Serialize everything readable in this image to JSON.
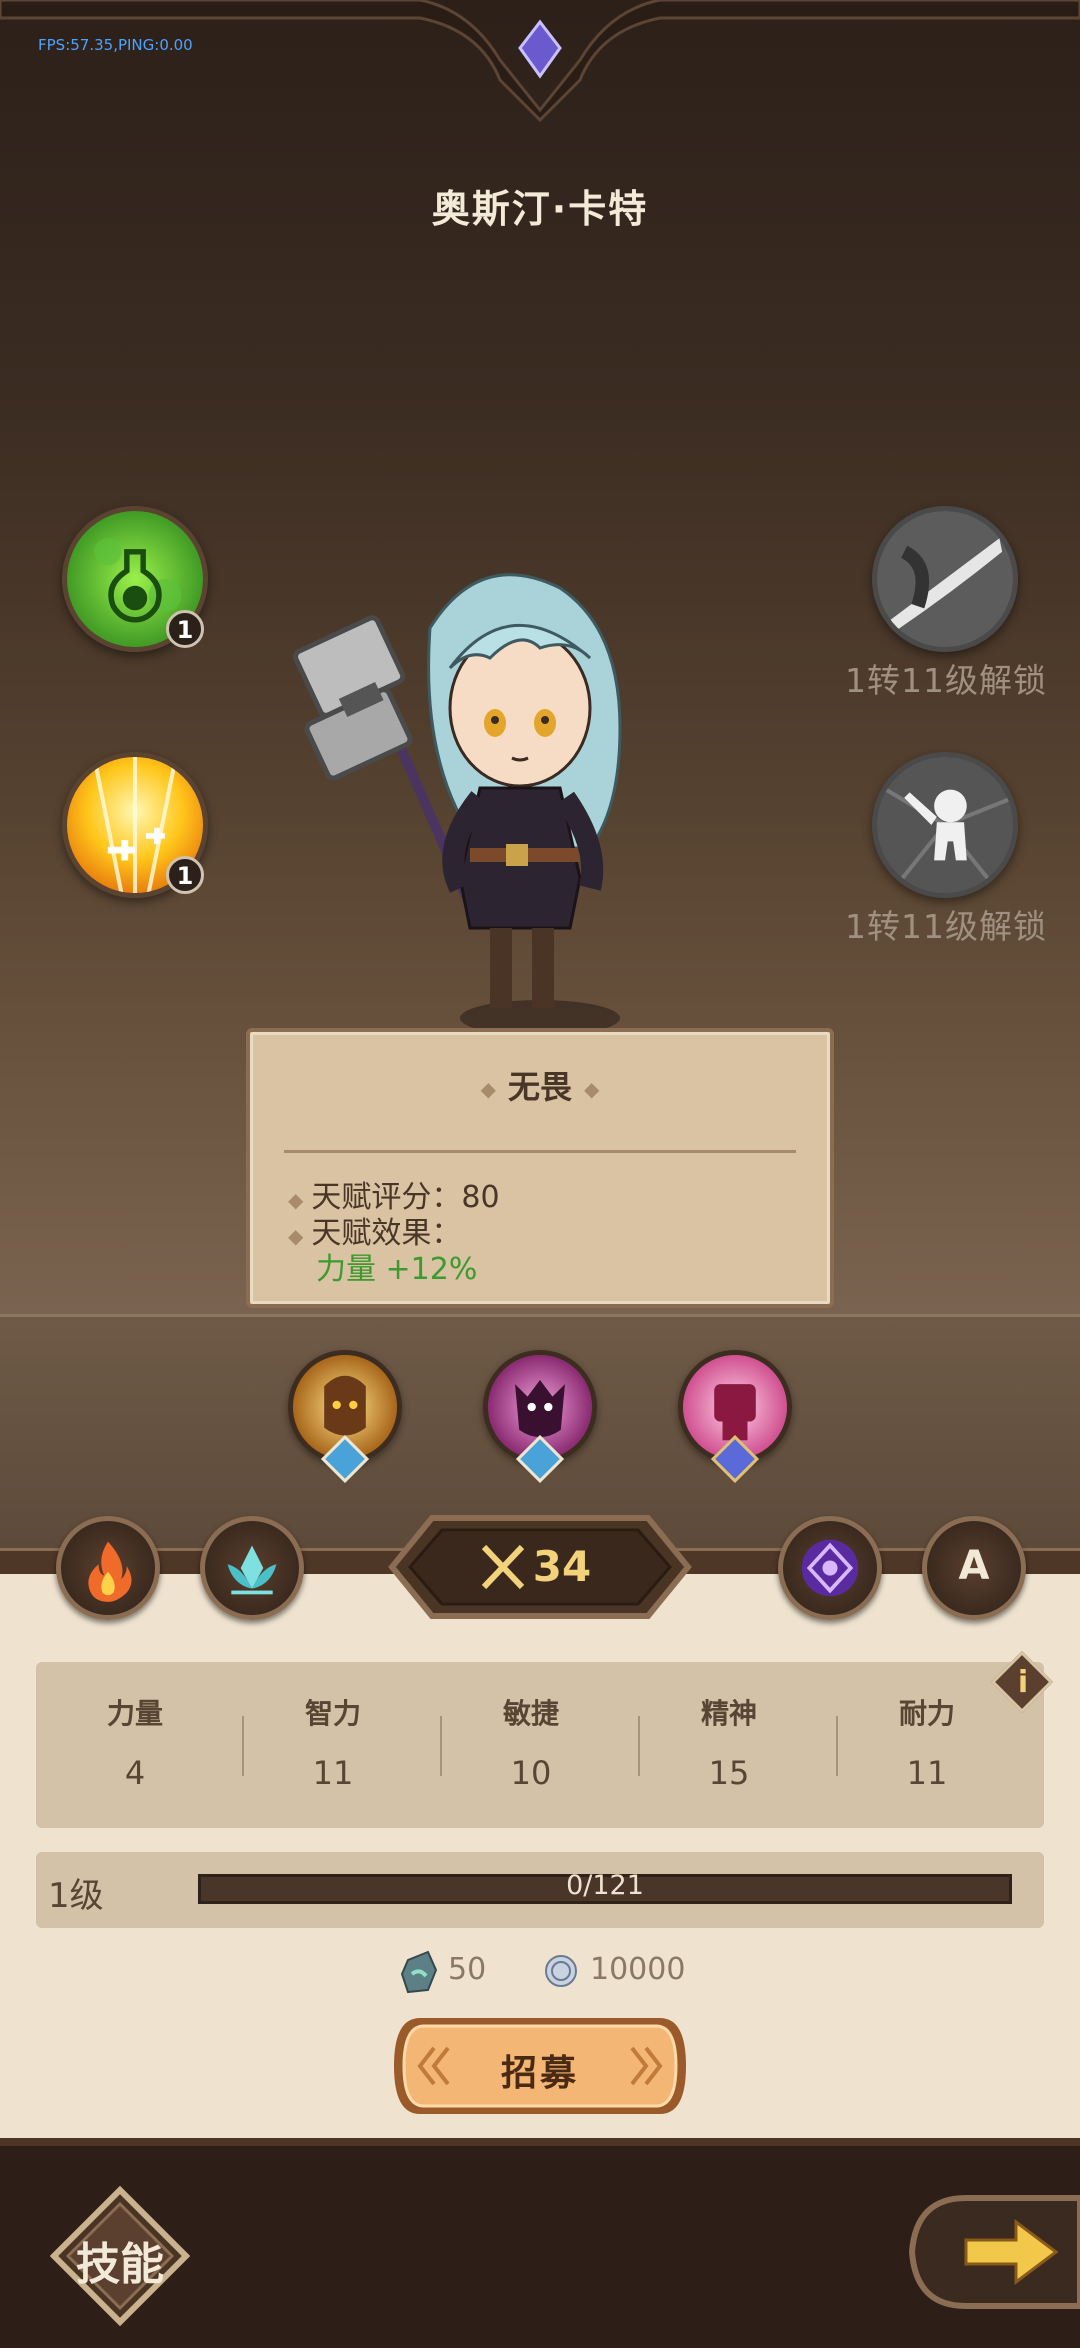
{
  "debug": {
    "fps": "FPS:57.35,PING:0.00"
  },
  "hero": {
    "name": "奥斯汀·卡特"
  },
  "left_skills": [
    {
      "name": "poison-potion",
      "count": "1"
    },
    {
      "name": "holy-light",
      "count": "1"
    }
  ],
  "right_skills": [
    {
      "name": "locked-slash",
      "locked_text": "1转11级解锁"
    },
    {
      "name": "locked-goblin",
      "locked_text": "1转11级解锁"
    }
  ],
  "talent": {
    "title": "无畏",
    "score_label": "天赋评分：",
    "score": "80",
    "effect_label": "天赋效果：",
    "effect": "力量 +12%"
  },
  "power": {
    "value": "34"
  },
  "mode_button": {
    "letter": "A"
  },
  "stats": [
    {
      "label": "力量",
      "value": "4"
    },
    {
      "label": "智力",
      "value": "11"
    },
    {
      "label": "敏捷",
      "value": "10"
    },
    {
      "label": "精神",
      "value": "15"
    },
    {
      "label": "耐力",
      "value": "11"
    }
  ],
  "level": {
    "label": "1级",
    "xp": "0/121",
    "progress": 0
  },
  "costs": [
    {
      "icon": "stone-icon",
      "value": "50"
    },
    {
      "icon": "coin-icon",
      "value": "10000"
    }
  ],
  "recruit": {
    "label": "招募"
  },
  "footer": {
    "skills_label": "技能"
  },
  "colors": {
    "effect_green": "#3d9a2e",
    "fps_blue": "#4aa3ff",
    "power_gold": "#f2d27a"
  }
}
